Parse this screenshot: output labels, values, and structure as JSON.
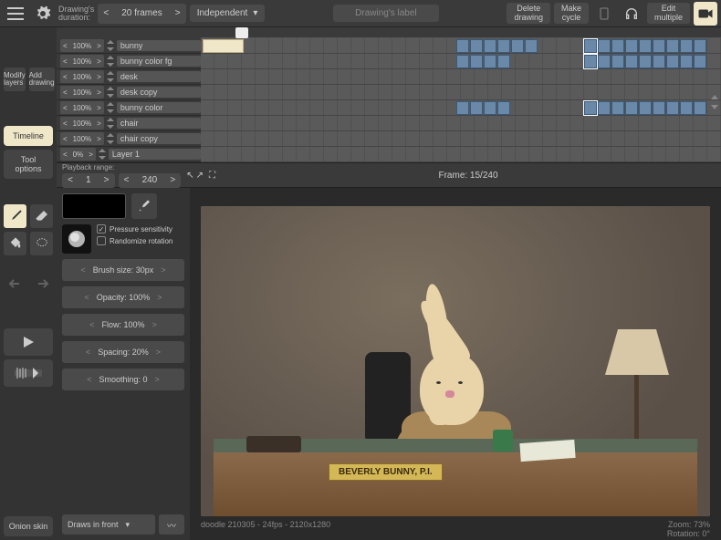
{
  "topbar": {
    "duration_label1": "Drawing's",
    "duration_label2": "duration:",
    "duration_value": "20 frames",
    "independent": "Independent",
    "drawing_label": "Drawing's label",
    "delete_drawing": "Delete\ndrawing",
    "make_cycle": "Make\ncycle",
    "edit_multiple": "Edit\nmultiple"
  },
  "leftbar": {
    "modify_layers": "Modify\nlayers",
    "add_drawing": "Add\ndrawing",
    "timeline_tab": "Timeline",
    "tool_options_tab": "Tool options",
    "onion_skin": "Onion skin"
  },
  "layers": [
    {
      "opacity": "100%",
      "name": "bunny"
    },
    {
      "opacity": "100%",
      "name": "bunny color fg"
    },
    {
      "opacity": "100%",
      "name": "desk"
    },
    {
      "opacity": "100%",
      "name": "desk copy"
    },
    {
      "opacity": "100%",
      "name": "bunny color"
    },
    {
      "opacity": "100%",
      "name": "chair"
    },
    {
      "opacity": "100%",
      "name": "chair copy"
    },
    {
      "opacity": "0%",
      "name": "Layer 1"
    }
  ],
  "playback": {
    "label": "Playback range:",
    "start": "1",
    "end": "240",
    "frame_info": "Frame: 15/240"
  },
  "options": {
    "pressure_sensitivity": "Pressure sensitivity",
    "randomize_rotation": "Randomize rotation",
    "brush_size": "Brush size: 30px",
    "opacity": "Opacity: 100%",
    "flow": "Flow: 100%",
    "spacing": "Spacing: 20%",
    "smoothing": "Smoothing: 0",
    "draws_in_front": "Draws in front"
  },
  "canvas": {
    "plaque": "BEVERLY BUNNY, P.I."
  },
  "status": {
    "left": "doodle 210305 - 24fps - 2120x1280",
    "zoom": "Zoom: 73%",
    "rotation": "Rotation: 0°"
  }
}
